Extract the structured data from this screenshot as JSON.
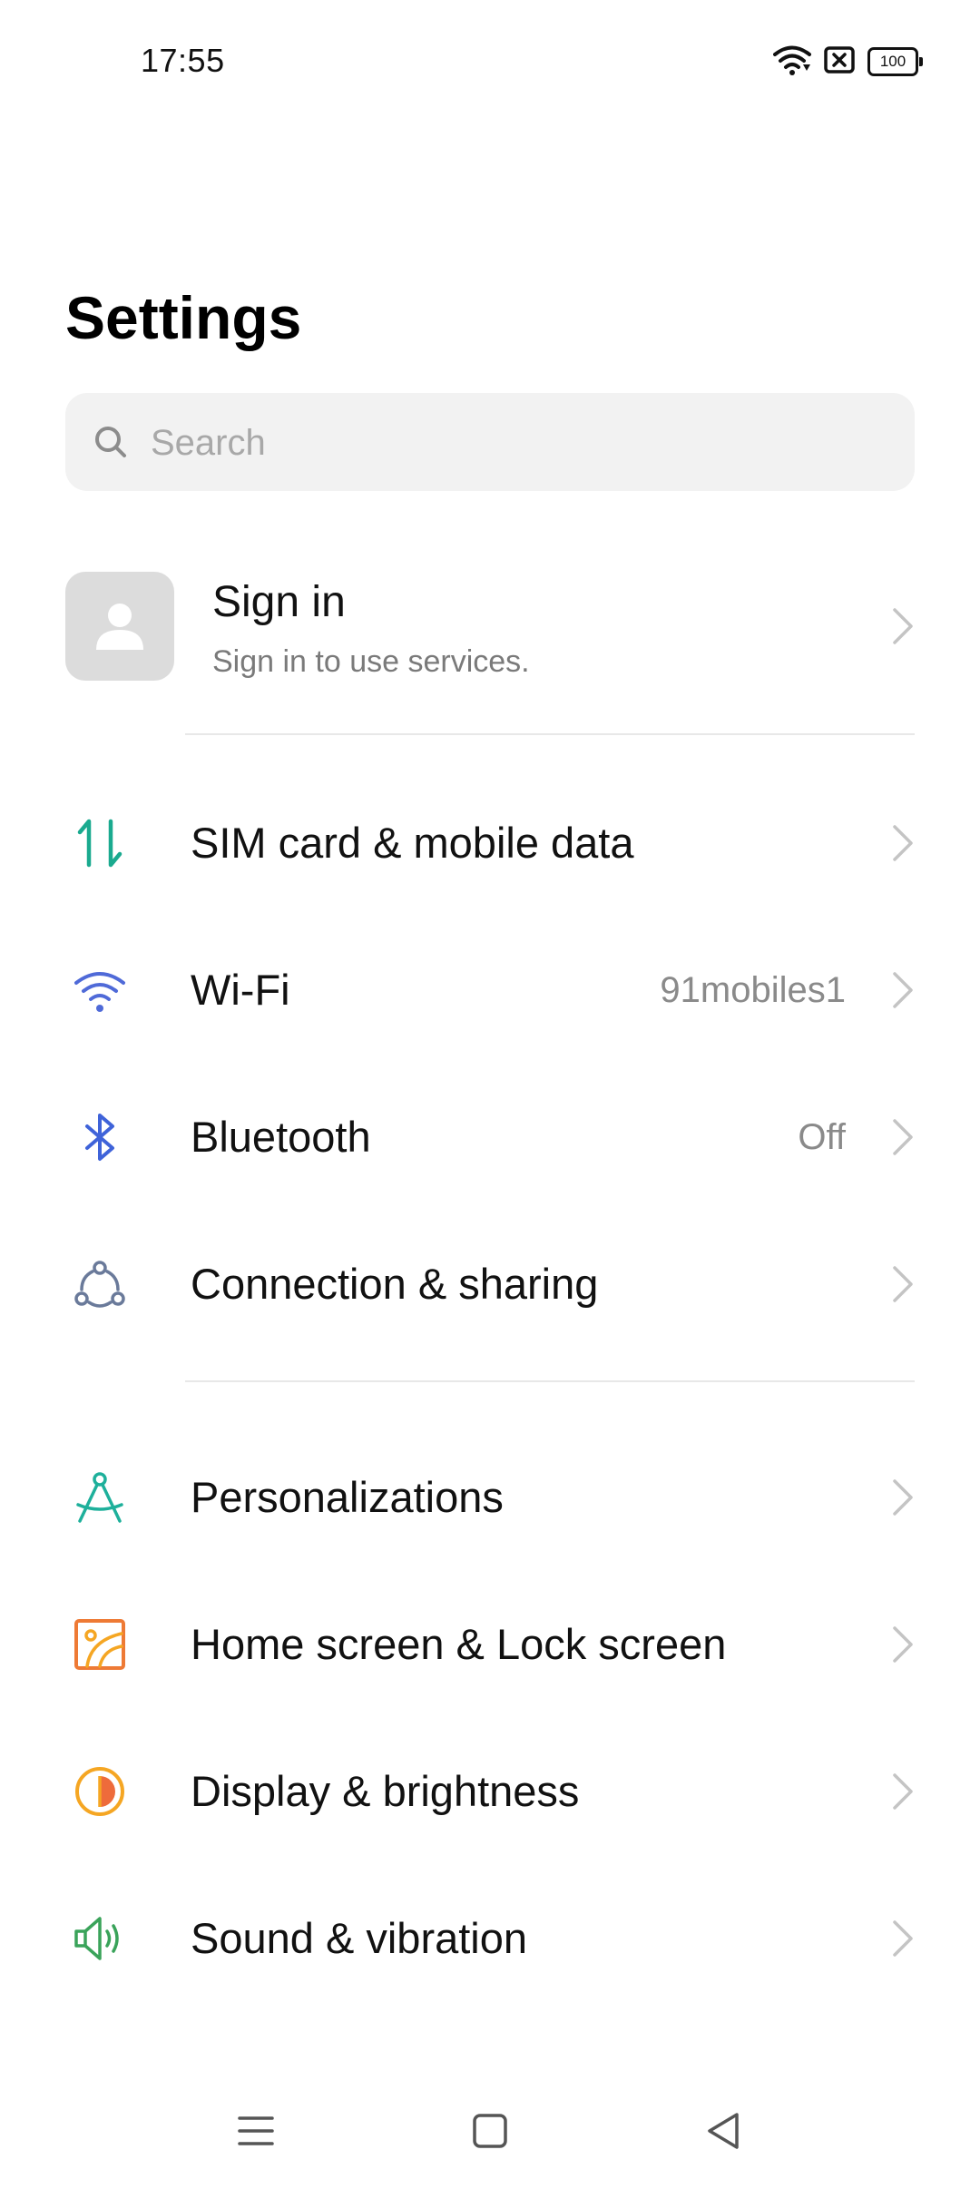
{
  "status_bar": {
    "time": "17:55",
    "battery": "100",
    "icons": [
      "wifi-icon",
      "sim-error-icon",
      "battery-icon"
    ]
  },
  "page": {
    "title": "Settings"
  },
  "search": {
    "placeholder": "Search"
  },
  "account": {
    "title": "Sign in",
    "subtitle": "Sign in to use services."
  },
  "groups": [
    {
      "items": [
        {
          "label": "SIM card & mobile data",
          "value": "",
          "icon": "mobile-data-icon",
          "color": "#1aaa8f"
        },
        {
          "label": "Wi-Fi",
          "value": "91mobiles1",
          "icon": "wifi-icon",
          "color": "#4f6ad8"
        },
        {
          "label": "Bluetooth",
          "value": "Off",
          "icon": "bluetooth-icon",
          "color": "#3f63d9"
        },
        {
          "label": "Connection & sharing",
          "value": "",
          "icon": "connection-sharing-icon",
          "color": "#6a7a9a"
        }
      ]
    },
    {
      "items": [
        {
          "label": "Personalizations",
          "value": "",
          "icon": "compass-icon",
          "color": "#1eb09b"
        },
        {
          "label": "Home screen & Lock screen",
          "value": "",
          "icon": "home-lock-screen-icon",
          "color": "#ee7a35"
        },
        {
          "label": "Display & brightness",
          "value": "",
          "icon": "display-brightness-icon",
          "color": "#f5a623"
        },
        {
          "label": "Sound & vibration",
          "value": "",
          "icon": "speaker-icon",
          "color": "#3aa35a"
        }
      ]
    }
  ],
  "nav_bar": {
    "buttons": [
      "menu-nav-icon",
      "home-nav-icon",
      "back-nav-icon"
    ]
  }
}
